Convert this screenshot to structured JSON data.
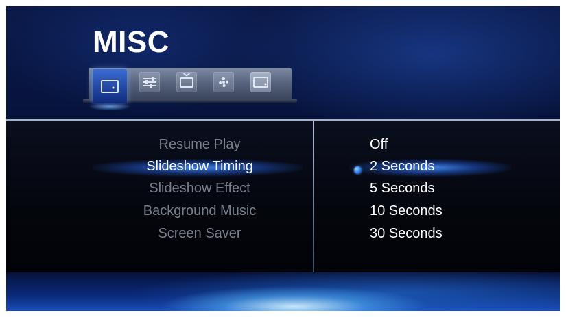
{
  "header": {
    "title": "MISC"
  },
  "tabs": [
    {
      "icon": "monitor-slideshow-icon",
      "active": true
    },
    {
      "icon": "sliders-icon",
      "active": false
    },
    {
      "icon": "tv-icon",
      "active": false
    },
    {
      "icon": "gear-icon",
      "active": false
    },
    {
      "icon": "monitor-slideshow-icon",
      "active": false
    }
  ],
  "menu": {
    "items": [
      {
        "label": "Resume Play"
      },
      {
        "label": "Slideshow Timing"
      },
      {
        "label": "Slideshow Effect"
      },
      {
        "label": "Background Music"
      },
      {
        "label": "Screen Saver"
      }
    ],
    "selected_index": 1
  },
  "options": {
    "items": [
      {
        "label": "Off"
      },
      {
        "label": "2 Seconds"
      },
      {
        "label": "5 Seconds"
      },
      {
        "label": "10 Seconds"
      },
      {
        "label": "30 Seconds"
      }
    ],
    "selected_index": 1
  },
  "colors": {
    "accent": "#2a6fe0",
    "text": "#ffffff",
    "dimmed_text": "#7a7f8c"
  }
}
